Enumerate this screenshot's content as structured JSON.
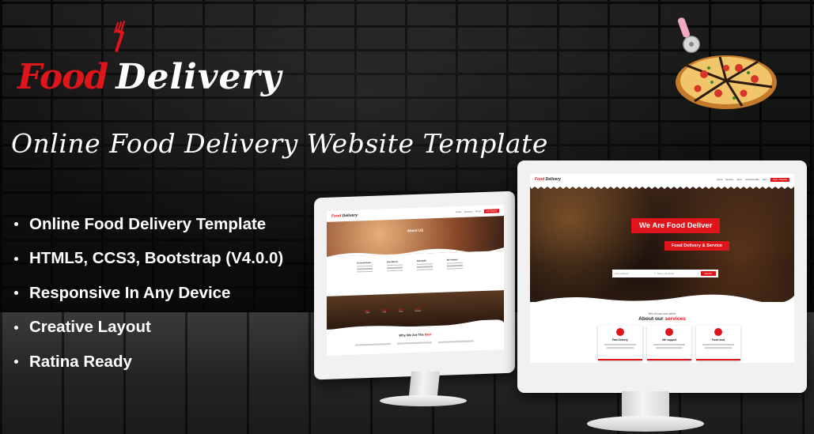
{
  "logo": {
    "food": "Food",
    "delivery": "Delivery"
  },
  "tagline": "Online Food  Delivery Website Template",
  "features": [
    "Online Food Delivery Template",
    "HTML5, CCS3, Bootstrap (V4.0.0)",
    "Responsive In Any Device",
    "Creative Layout",
    "Ratina Ready"
  ],
  "colors": {
    "accent": "#e0151b",
    "text": "#ffffff",
    "background": "#141414"
  },
  "icons": {
    "logo_mark": "fork-icon",
    "decoration": "pizza-icon"
  },
  "large_screen": {
    "logo_food": "Food",
    "logo_delivery": "Delivery",
    "nav": [
      "Home",
      "Services",
      "About",
      "Contact Details",
      "Team"
    ],
    "nav_cta": "Login / Register",
    "hero_title": "We Are Food Deliver",
    "hero_subtitle": "Food Delivery & Service",
    "search_field_1": "Enter Address",
    "search_field_2": "Enter your Email",
    "search_button": "Search",
    "about_small": "Why choose food deliver",
    "about_title": "About our",
    "about_title_accent": "services",
    "cards": [
      {
        "title": "Fast Delivery"
      },
      {
        "title": "24h support"
      },
      {
        "title": "Fresh food"
      }
    ]
  },
  "small_screen": {
    "logo_food": "Food",
    "logo_delivery": "Delivery",
    "nav_cta": "Get Started",
    "hero_title": "About US",
    "columns": [
      "Ut scelerisque",
      "Doe Mauris",
      "Sed Nulla",
      "Mo tempus"
    ],
    "stats": [
      {
        "value": "250+",
        "label": "Staff"
      },
      {
        "value": "375+",
        "label": "Staff"
      },
      {
        "value": "150+",
        "label": "Items"
      },
      {
        "value": "375+",
        "label": "Delivery"
      }
    ],
    "why_title": "Why We Are The",
    "why_accent": "Best"
  }
}
